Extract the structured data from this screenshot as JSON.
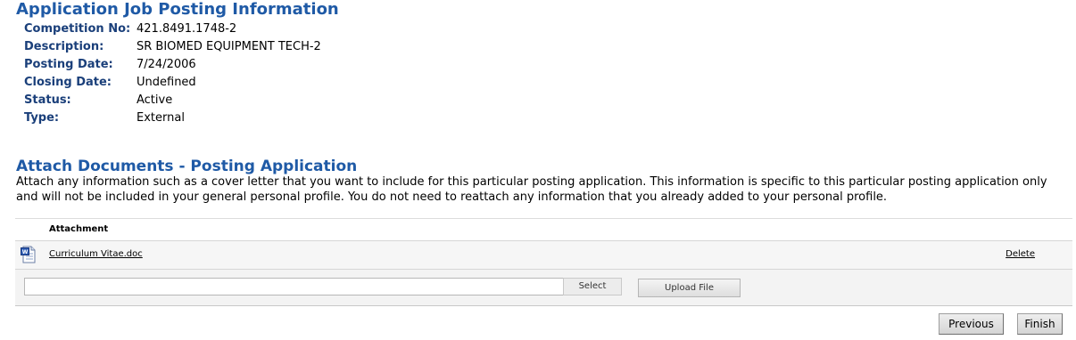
{
  "job_info": {
    "title": "Application Job Posting Information",
    "rows": [
      {
        "label": "Competition No:",
        "value": "421.8491.1748-2"
      },
      {
        "label": "Description:",
        "value": "SR BIOMED EQUIPMENT TECH-2"
      },
      {
        "label": "Posting Date:",
        "value": "7/24/2006"
      },
      {
        "label": "Closing Date:",
        "value": "Undefined"
      },
      {
        "label": "Status:",
        "value": "Active"
      },
      {
        "label": "Type:",
        "value": "External"
      }
    ]
  },
  "attach": {
    "title": "Attach Documents - Posting Application",
    "description_line1": "Attach any information such as a cover letter that you want to include for this particular posting application. This information is specific to this particular posting application only",
    "description_line2": "and will not be included in your general personal profile. You do not need to reattach any information that you already added to your personal profile.",
    "table": {
      "header": "Attachment",
      "files": [
        {
          "name": "Curriculum Vitae.doc",
          "delete_label": "Delete",
          "icon": "word-document-icon"
        }
      ]
    },
    "file_input_value": "",
    "select_label": "Select",
    "upload_label": "Upload File"
  },
  "nav": {
    "previous_label": "Previous",
    "finish_label": "Finish"
  },
  "colors": {
    "heading": "#1f5aa6",
    "label": "#1a3f7a",
    "panel_bg": "#f3f3f3"
  }
}
